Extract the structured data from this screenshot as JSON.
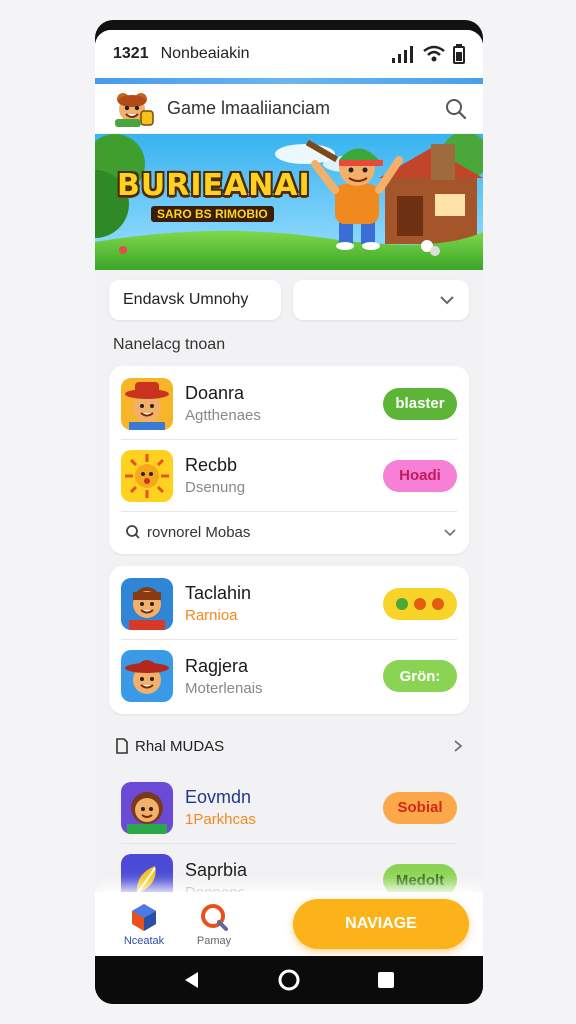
{
  "status_bar": {
    "time": "1321",
    "carrier": "Nonbeaiakin"
  },
  "app_bar": {
    "title": "Game lmaaliianciam"
  },
  "banner": {
    "title": "BURIEANAI",
    "subtitle": "SARO BS RIMOBIO"
  },
  "filters": {
    "left_label": "Endavsk Umnohy",
    "right_value": ""
  },
  "section": {
    "title": "Nanelacg tnoan"
  },
  "group1": [
    {
      "name": "Doanra",
      "sub": "Agtthenaes",
      "action": "blaster",
      "pill_bg": "#5cb536",
      "pill_fg": "#ffffff",
      "icon": "cowboy-avatar-icon"
    },
    {
      "name": "Recbb",
      "sub": "Dsenung",
      "action": "Hoadi",
      "pill_bg": "#f77fd6",
      "pill_fg": "#c21a5a",
      "icon": "sun-face-icon"
    }
  ],
  "more_link": {
    "label": "rovnorel Mobas"
  },
  "group2": [
    {
      "name": "Taclahin",
      "sub": "Rarnioa",
      "sub_color": "orange",
      "action": "&lt;&gt;&lt;&gt;",
      "pill_bg": "#f8d428",
      "pill_fg": "#e45d12",
      "icon": "boy-avatar-icon"
    },
    {
      "name": "Ragjera",
      "sub": "Moterlenais",
      "action": "Grön:",
      "pill_bg": "#8bd453",
      "pill_fg": "#ffffff",
      "icon": "hat-avatar-icon"
    }
  ],
  "group3_header": {
    "label": "Rhal MUDAS"
  },
  "group3": [
    {
      "name": "Eovmdn",
      "sub": "1Parkhcas",
      "sub_color": "orange",
      "action": "Sobial",
      "pill_bg": "#fba84a",
      "pill_fg": "#d3281d",
      "icon": "girl-avatar-icon"
    },
    {
      "name": "Saprbia",
      "sub": "Donnons",
      "action": "Medolt",
      "pill_bg": "#8bd453",
      "pill_fg": "#2f6a14",
      "icon": "leaf-sport-icon"
    }
  ],
  "bottom_nav": {
    "items": [
      {
        "label": "Nceatak",
        "icon": "cube-icon",
        "color": "#2a4fa8"
      },
      {
        "label": "Pamay",
        "icon": "quest-icon",
        "color": "#666666"
      }
    ],
    "cta": "NAVIAGE"
  },
  "colors": {
    "accent": "#fcb31a",
    "green": "#5cb536"
  }
}
